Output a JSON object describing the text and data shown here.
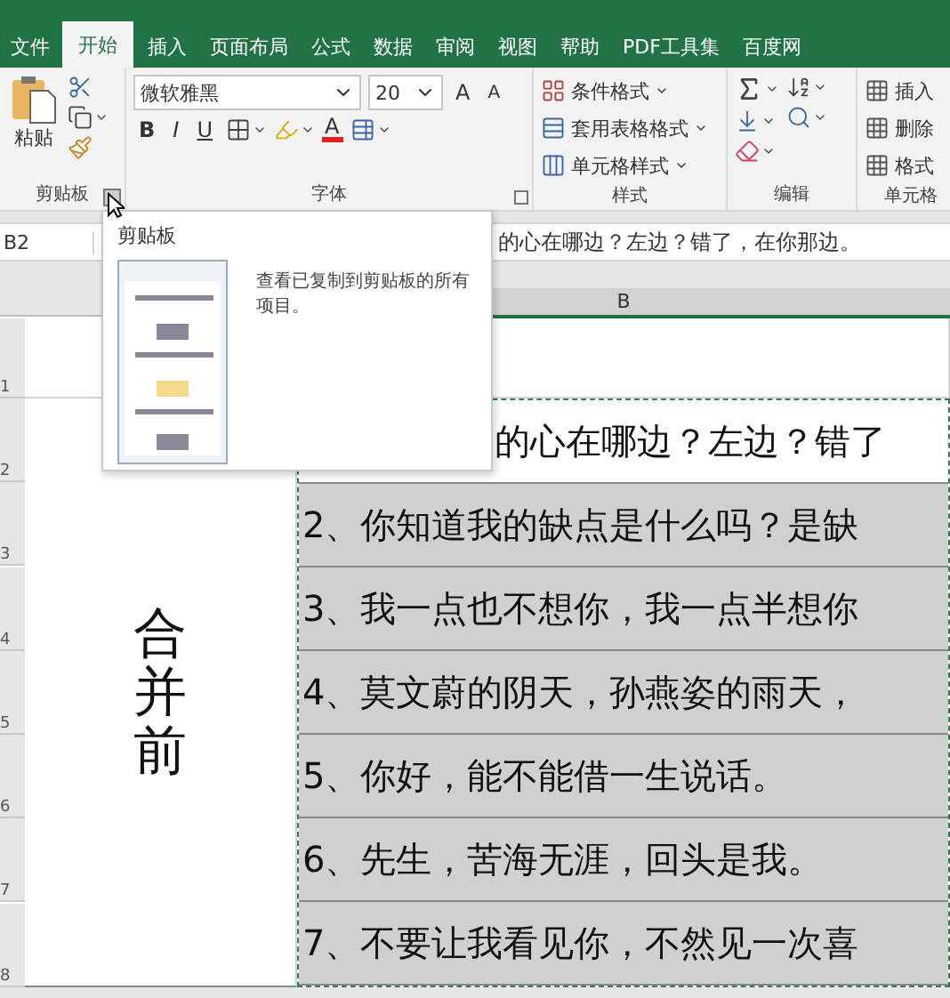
{
  "tabs": [
    {
      "label": "文件",
      "selected": false
    },
    {
      "label": "开始",
      "selected": true
    },
    {
      "label": "插入",
      "selected": false
    },
    {
      "label": "页面布局",
      "selected": false
    },
    {
      "label": "公式",
      "selected": false
    },
    {
      "label": "数据",
      "selected": false
    },
    {
      "label": "审阅",
      "selected": false
    },
    {
      "label": "视图",
      "selected": false
    },
    {
      "label": "帮助",
      "selected": false
    },
    {
      "label": "PDF工具集",
      "selected": false
    },
    {
      "label": "百度网",
      "selected": false
    }
  ],
  "clipboard": {
    "paste_label": "粘贴",
    "group_label": "剪贴板"
  },
  "font": {
    "name": "微软雅黑",
    "size": "20",
    "grow": "A",
    "shrink": "A",
    "bold": "B",
    "italic": "I",
    "underline": "U",
    "font_color": "A",
    "group_label": "字体"
  },
  "styles": {
    "items": [
      "条件格式",
      "套用表格格式",
      "单元格样式"
    ],
    "group_label": "样式"
  },
  "editing": {
    "group_label": "编辑"
  },
  "cells": {
    "items": [
      "插入",
      "删除",
      "格式"
    ],
    "group_label": "单元格"
  },
  "formula_bar": {
    "name_box": "B2",
    "content": "的心在哪边？左边？错了，在你那边。"
  },
  "tooltip": {
    "title": "剪贴板",
    "description": "查看已复制到剪贴板的所有项目。"
  },
  "sheet": {
    "column_header": "B",
    "row_numbers": [
      "1",
      "2",
      "3",
      "4",
      "5",
      "6",
      "7",
      "8"
    ],
    "merged_cell": "合并前",
    "rows": [
      {
        "text": "的心在哪边？左边？错了",
        "active": true
      },
      {
        "text": "2、你知道我的缺点是什么吗？是缺",
        "active": false
      },
      {
        "text": "3、我一点也不想你，我一点半想你",
        "active": false
      },
      {
        "text": "4、莫文蔚的阴天，孙燕姿的雨天，",
        "active": false
      },
      {
        "text": "5、你好，能不能借一生说话。",
        "active": false
      },
      {
        "text": "6、先生，苦海无涯，回头是我。",
        "active": false
      },
      {
        "text": "7、不要让我看见你，不然见一次喜",
        "active": false
      }
    ]
  }
}
